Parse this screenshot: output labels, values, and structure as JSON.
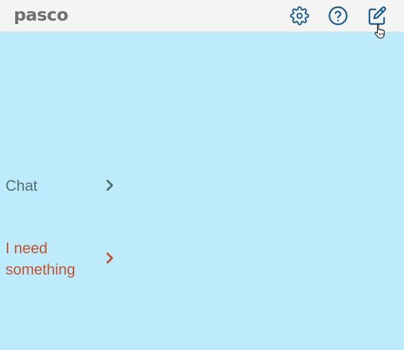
{
  "app": {
    "logo": "pasco"
  },
  "header": {
    "icons": [
      "gear-icon",
      "question-circle-icon",
      "edit-icon"
    ]
  },
  "menu": {
    "items": [
      {
        "label": "Chat",
        "color": "#4f6f6f",
        "icon": "chevron-right-icon"
      },
      {
        "label": "I need something",
        "color": "#c0532f",
        "icon": "chevron-right-icon"
      }
    ]
  },
  "colors": {
    "background": "#bdebfb",
    "header": "#f4f4f4",
    "icon_blue": "#1d5c8f"
  }
}
